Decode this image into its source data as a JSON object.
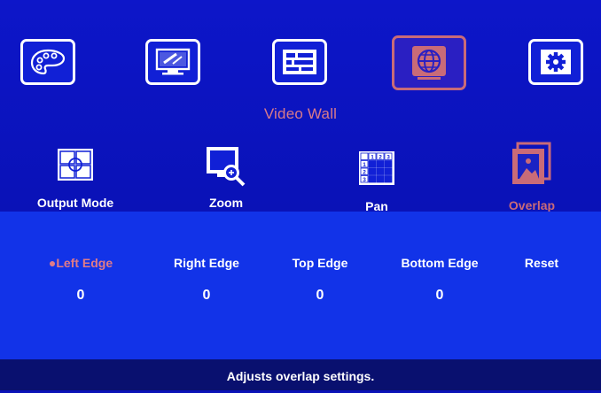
{
  "top_menu": {
    "items": [
      {
        "icon": "palette-icon"
      },
      {
        "icon": "monitor-edit-icon"
      },
      {
        "icon": "input-source-icon"
      },
      {
        "icon": "globe-icon",
        "selected": true
      },
      {
        "icon": "gear-icon"
      }
    ],
    "title": "Video Wall"
  },
  "sub_menu": {
    "items": [
      {
        "label": "Output Mode",
        "icon": "output-mode-icon"
      },
      {
        "label": "Zoom",
        "icon": "zoom-icon"
      },
      {
        "label": "Pan",
        "icon": "pan-grid-icon",
        "grid": [
          "1",
          "2",
          "3",
          "1",
          "2",
          "3"
        ]
      },
      {
        "label": "Overlap",
        "icon": "overlap-icon",
        "selected": true
      }
    ]
  },
  "overlap_panel": {
    "params": [
      {
        "label": "●Left Edge",
        "value": "0",
        "active": true
      },
      {
        "label": "Right Edge",
        "value": "0"
      },
      {
        "label": "Top Edge",
        "value": "0"
      },
      {
        "label": "Bottom Edge",
        "value": "0"
      },
      {
        "label": "Reset",
        "value": ""
      }
    ]
  },
  "status_bar": {
    "text": "Adjusts overlap settings."
  },
  "colors": {
    "background": "#0a12b8",
    "panel": "#1233e8",
    "status_bar": "#09106f",
    "selected_accent": "#c96b78",
    "text": "#ffffff"
  }
}
